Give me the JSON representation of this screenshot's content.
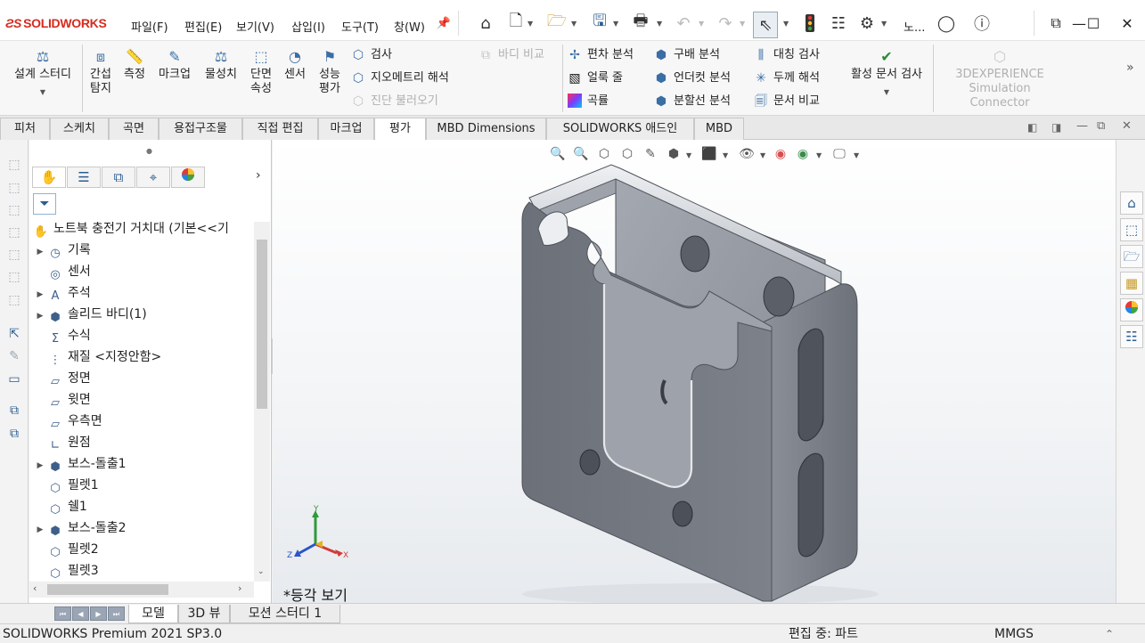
{
  "app": {
    "brand": "SOLIDWORKS",
    "doc_name_short": "노..."
  },
  "menu": [
    "파일(F)",
    "편집(E)",
    "보기(V)",
    "삽입(I)",
    "도구(T)",
    "창(W)"
  ],
  "ribbon": {
    "design_study": "설계 스터디",
    "interference_1": "간섭",
    "interference_2": "탐지",
    "measure": "측정",
    "markup": "마크업",
    "mass_props": "물성치",
    "section_1": "단면",
    "section_2": "속성",
    "sensor": "센서",
    "perf_1": "성능",
    "perf_2": "평가",
    "check": "검사",
    "geometry_analysis": "지오메트리 해석",
    "import_diag": "진단 불러오기",
    "body_compare": "바디 비교",
    "deviation": "편차 분석",
    "zebra": "얼룩 줄",
    "curvature": "곡률",
    "draft": "구배 분석",
    "undercut": "언더컷 분석",
    "parting": "분할선 분석",
    "symmetry": "대칭 검사",
    "thickness": "두께 해석",
    "doc_compare": "문서 비교",
    "active_doc_check": "활성 문서 검사",
    "exp_1": "3DEXPERIENCE",
    "exp_2": "Simulation Connector"
  },
  "tabs": [
    "피처",
    "스케치",
    "곡면",
    "용접구조물",
    "직접 편집",
    "마크업",
    "평가",
    "MBD Dimensions",
    "SOLIDWORKS 애드인",
    "MBD"
  ],
  "active_tab": "평가",
  "tree": {
    "root": "노트북 충전기 거치대  (기본<<기",
    "items": [
      {
        "label": "기록",
        "icon": "history-icon",
        "expandable": true
      },
      {
        "label": "센서",
        "icon": "sensor-icon",
        "expandable": false
      },
      {
        "label": "주석",
        "icon": "annotation-icon",
        "expandable": true
      },
      {
        "label": "솔리드 바디(1)",
        "icon": "solid-body-icon",
        "expandable": true
      },
      {
        "label": "수식",
        "icon": "equation-icon",
        "expandable": false
      },
      {
        "label": "재질 <지정안함>",
        "icon": "material-icon",
        "expandable": false
      },
      {
        "label": "정면",
        "icon": "plane-icon",
        "expandable": false
      },
      {
        "label": "윗면",
        "icon": "plane-icon",
        "expandable": false
      },
      {
        "label": "우측면",
        "icon": "plane-icon",
        "expandable": false
      },
      {
        "label": "원점",
        "icon": "origin-icon",
        "expandable": false
      },
      {
        "label": "보스-돌출1",
        "icon": "extrude-icon",
        "expandable": true
      },
      {
        "label": "필렛1",
        "icon": "fillet-icon",
        "expandable": false
      },
      {
        "label": "쉘1",
        "icon": "shell-icon",
        "expandable": false
      },
      {
        "label": "보스-돌출2",
        "icon": "extrude-icon",
        "expandable": true
      },
      {
        "label": "필렛2",
        "icon": "fillet-icon",
        "expandable": false
      },
      {
        "label": "필렛3",
        "icon": "fillet-icon",
        "expandable": false
      }
    ]
  },
  "viewport": {
    "view_name": "*등각 보기",
    "axis_x": "X",
    "axis_y": "Y",
    "axis_z": "Z"
  },
  "bottom_tabs": [
    "모델",
    "3D 뷰",
    "모션 스터디 1"
  ],
  "status": {
    "product": "SOLIDWORKS Premium 2021 SP3.0",
    "mode": "편집 중: 파트",
    "units": "MMGS"
  },
  "colors": {
    "brand_red": "#d52b1e",
    "part_gray": "#7b7f87",
    "accent_blue": "#2c5d91"
  }
}
